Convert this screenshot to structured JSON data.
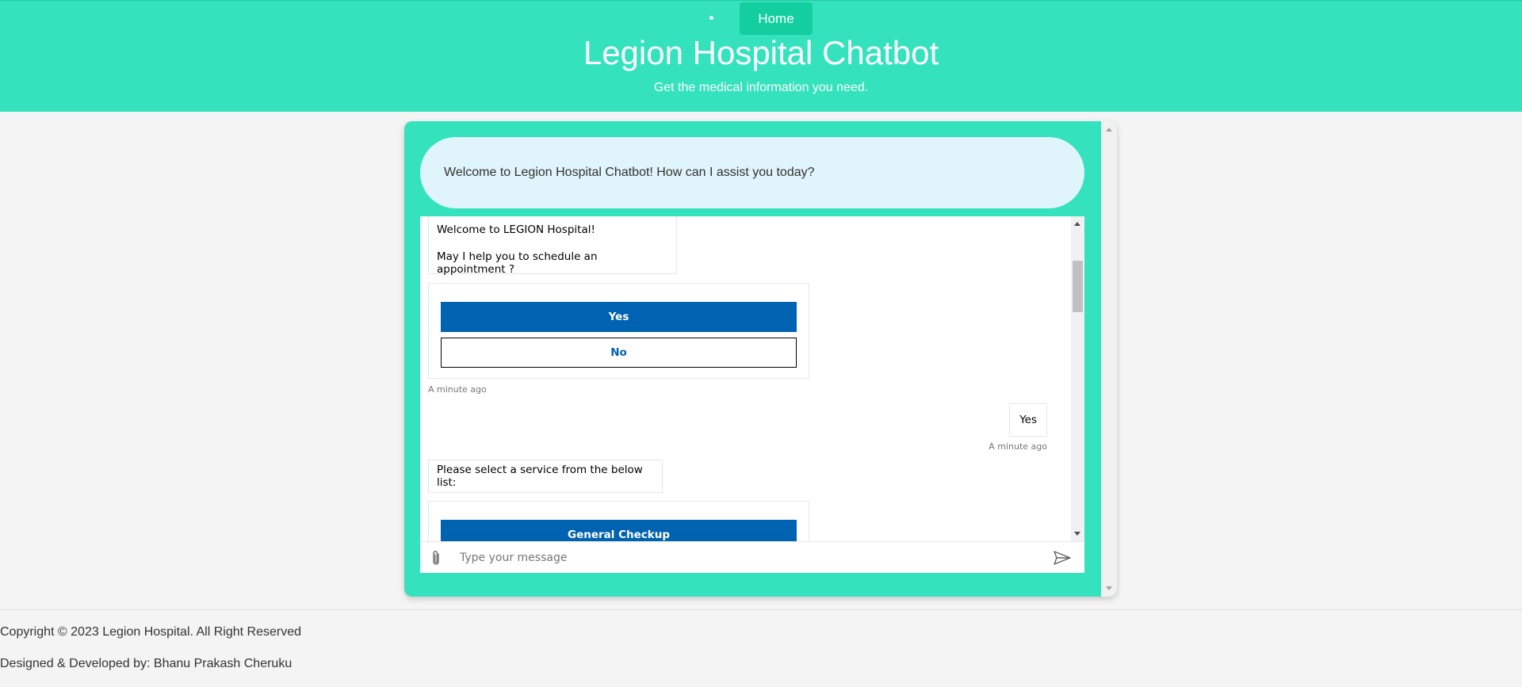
{
  "header": {
    "nav_home": "Home",
    "title": "Legion Hospital Chatbot",
    "subtitle": "Get the medical information you need."
  },
  "chat": {
    "welcome": "Welcome to Legion Hospital Chatbot! How can I assist you today?",
    "messages": [
      {
        "from": "bot",
        "lines": [
          "Welcome to LEGION Hospital!",
          "May I help you to schedule an appointment ?"
        ]
      },
      {
        "from": "bot",
        "card_buttons": [
          "Yes",
          "No"
        ],
        "timestamp": "A minute ago"
      },
      {
        "from": "user",
        "text": "Yes",
        "timestamp": "A minute ago"
      },
      {
        "from": "bot",
        "text": "Please select a service from the below list:"
      },
      {
        "from": "bot",
        "card_buttons": [
          "General Checkup"
        ]
      }
    ],
    "input_placeholder": "Type your message"
  },
  "footer": {
    "copyright": "Copyright © 2023 Legion Hospital. All Right Reserved",
    "credit": "Designed & Developed by: Bhanu Prakash Cheruku"
  },
  "colors": {
    "header_bg": "#34e3bd",
    "nav_button": "#13cf9f",
    "primary_button": "#0063b1",
    "banner_bg": "#e0f4fb"
  },
  "icons": [
    "paperclip-icon",
    "send-icon"
  ]
}
